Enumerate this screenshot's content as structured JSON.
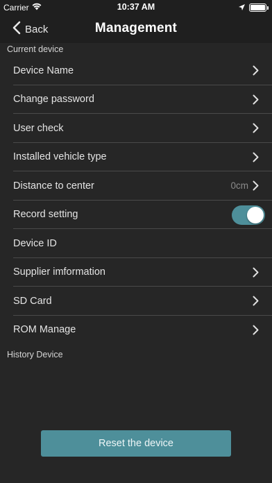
{
  "status_bar": {
    "carrier": "Carrier",
    "time": "10:37 AM",
    "battery_level": 1.0
  },
  "nav": {
    "back_label": "Back",
    "title": "Management"
  },
  "sections": {
    "current": "Current device",
    "history": "History Device"
  },
  "rows": {
    "device_name": "Device Name",
    "change_password": "Change password",
    "user_check": "User check",
    "vehicle_type": "Installed vehicle type",
    "distance": "Distance to center",
    "distance_value": "0cm",
    "record_setting": "Record setting",
    "record_setting_on": true,
    "device_id": "Device ID",
    "supplier": "Supplier imformation",
    "sd_card": "SD Card",
    "rom_manage": "ROM Manage"
  },
  "reset_button": "Reset the device",
  "colors": {
    "accent": "#4e8f9a",
    "background": "#262626",
    "bar": "#1f1f1f"
  }
}
